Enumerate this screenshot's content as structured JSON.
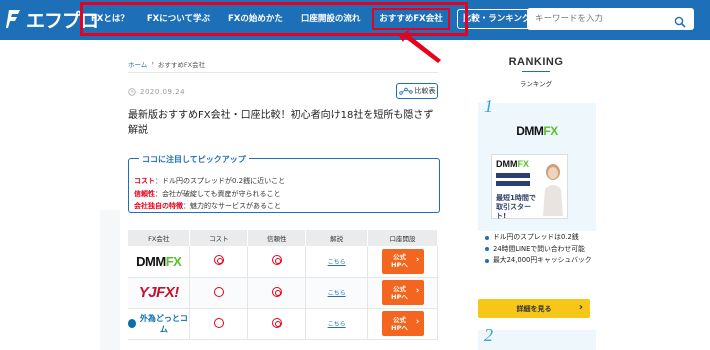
{
  "logo": {
    "text": "エフプロ"
  },
  "nav": {
    "items": [
      "FXとは？",
      "FXについて学ぶ",
      "FXの始めかた",
      "口座開設の流れ",
      "おすすめFX会社"
    ],
    "compare_label": "比較・ランキング"
  },
  "search": {
    "placeholder": "キーワードを入力"
  },
  "breadcrumb": {
    "home": "ホーム",
    "sep": "›",
    "current": "おすすめFX会社"
  },
  "article": {
    "date": "2020.09.24",
    "compare_button": "比較表",
    "title": "最新版おすすめFX会社・口座比較！初心者向け18社を短所も隠さず解説"
  },
  "pickup": {
    "heading": "ココに注目してピックアップ",
    "items": [
      {
        "key": "コスト",
        "text": "：ドル円のスプレッドが0.2銭に近いこと"
      },
      {
        "key": "信頼性",
        "text": "：会社が破綻しても資産が守られること"
      },
      {
        "key": "会社独自の特徴",
        "text": "：魅力的なサービスがあること"
      }
    ]
  },
  "table": {
    "headers": [
      "FX会社",
      "コスト",
      "信頼性",
      "解説",
      "口座開設"
    ],
    "rows": [
      {
        "company_logo": "DMM FX",
        "cost_mark": "◎",
        "trust_mark": "◎",
        "link": "こちら",
        "btn": "公式HPへ"
      },
      {
        "company_logo": "YJFX!",
        "cost_mark": "○",
        "trust_mark": "◎",
        "link": "こちら",
        "btn": "公式HPへ"
      },
      {
        "company_logo": "外為どっとコム",
        "cost_mark": "○",
        "trust_mark": "◎",
        "link": "こちら",
        "btn": "公式HPへ"
      }
    ],
    "logo_parts": {
      "dmm": "DMM",
      "fx": "FX",
      "yjfx": "YJFX!"
    }
  },
  "ranking": {
    "title": "RANKING",
    "subtitle": "ランキング",
    "first": {
      "rank": "1",
      "logo_dmm": "DMM",
      "logo_fx": "FX",
      "banner_logo_dmm": "DMM",
      "banner_logo_fx": "FX",
      "banner_text": "最短1時間で取引スタート!",
      "features": [
        "ドル円のスプレッドは0.2銭",
        "24時間LINEで問い合わせ可能",
        "最大24,000円キャッシュバック"
      ],
      "detail_button": "詳細を見る"
    },
    "second": {
      "rank": "2"
    }
  },
  "colors": {
    "header": "#1d6fb8",
    "highlight": "#e8001c",
    "cta_orange": "#f2661f",
    "cta_yellow": "#f6c619"
  }
}
